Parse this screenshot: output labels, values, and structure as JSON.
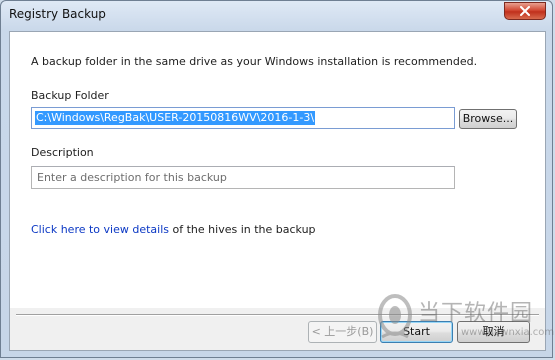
{
  "window": {
    "title": "Registry Backup",
    "close_icon": "close-icon"
  },
  "form": {
    "intro_text": "A backup folder in the same drive as your Windows installation is recommended.",
    "folder_label": "Backup Folder",
    "folder_value": "C:\\Windows\\RegBak\\USER-20150816WV\\2016-1-3\\",
    "browse_label": "Browse...",
    "description_label": "Description",
    "description_value": "",
    "description_placeholder": "Enter a description for this backup",
    "hives_link_text": "Click here to view details",
    "hives_suffix": " of the hives in the backup"
  },
  "buttons": {
    "back_label": "< 上一步(B)",
    "start_label": "Start",
    "cancel_label": "取消"
  },
  "watermark": {
    "text": "当下软件园",
    "url": "www.downxia.com",
    "logo_icon": "downxia-logo-icon"
  },
  "colors": {
    "link": "#0b38c4",
    "selection": "#3399ff",
    "close_button": "#c0301c"
  }
}
